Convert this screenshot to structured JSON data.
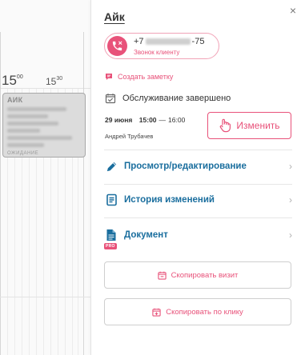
{
  "calendar": {
    "hour_label": "15",
    "hour_minutes": "00",
    "half_hour_label": "15",
    "half_hour_minutes": "30",
    "event": {
      "title": "АИК",
      "footer": "ОЖИДАНИЕ"
    }
  },
  "panel": {
    "close_symbol": "×",
    "client_name": "Айк",
    "call": {
      "phone_prefix": "+7",
      "phone_suffix": "-75",
      "label": "Звонок клиенту"
    },
    "note_action": "Создать заметку",
    "status": "Обслуживание завершено",
    "visit": {
      "date": "29 июня",
      "start": "15:00",
      "dash": "—",
      "end": "16:00"
    },
    "master": "Андрей Трубачев",
    "change_button": "Изменить",
    "menu": [
      {
        "label": "Просмотр/редактирование",
        "icon": "pencil-icon"
      },
      {
        "label": "История изменений",
        "icon": "history-icon"
      },
      {
        "label": "Документ",
        "icon": "document-icon",
        "badge": "PRO"
      }
    ],
    "chevron": "›",
    "copy_visit": "Скопировать визит",
    "copy_by_click": "Скопировать по клику"
  },
  "colors": {
    "accent_pink": "#e8527a",
    "link_blue": "#1a6e9e"
  }
}
